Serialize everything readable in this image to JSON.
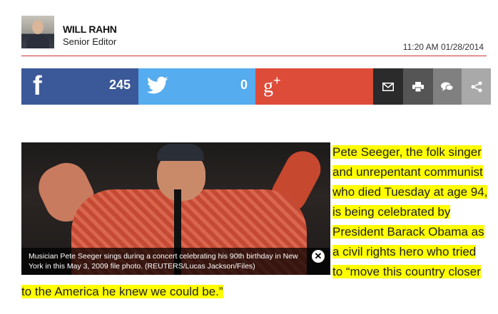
{
  "author": {
    "name": "WILL RAHN",
    "title": "Senior Editor",
    "timestamp": "11:20 AM 01/28/2014"
  },
  "share": {
    "facebook": {
      "icon": "facebook-icon",
      "count": "245",
      "color": "#3b5998"
    },
    "twitter": {
      "icon": "twitter-icon",
      "count": "0",
      "color": "#55acee"
    },
    "googleplus": {
      "icon": "google-plus-icon",
      "color": "#dd4b39"
    },
    "email": {
      "icon": "mail-icon"
    },
    "print": {
      "icon": "print-icon"
    },
    "comments": {
      "icon": "chat-icon"
    },
    "more": {
      "icon": "share-icon"
    }
  },
  "image": {
    "caption": "Musician Pete Seeger sings during a concert celebrating his 90th birthday in New York in this May 3, 2009 file photo. (REUTERS/Lucas Jackson/Files)"
  },
  "article": {
    "highlight_color": "#ffff00",
    "lead_text": "Pete Seeger, the folk singer and unrepentant communist who died Tuesday at age 94, is being celebrated by President Barack Obama as a civil rights hero who tried to “move this country closer to the America he knew we could be.”"
  }
}
